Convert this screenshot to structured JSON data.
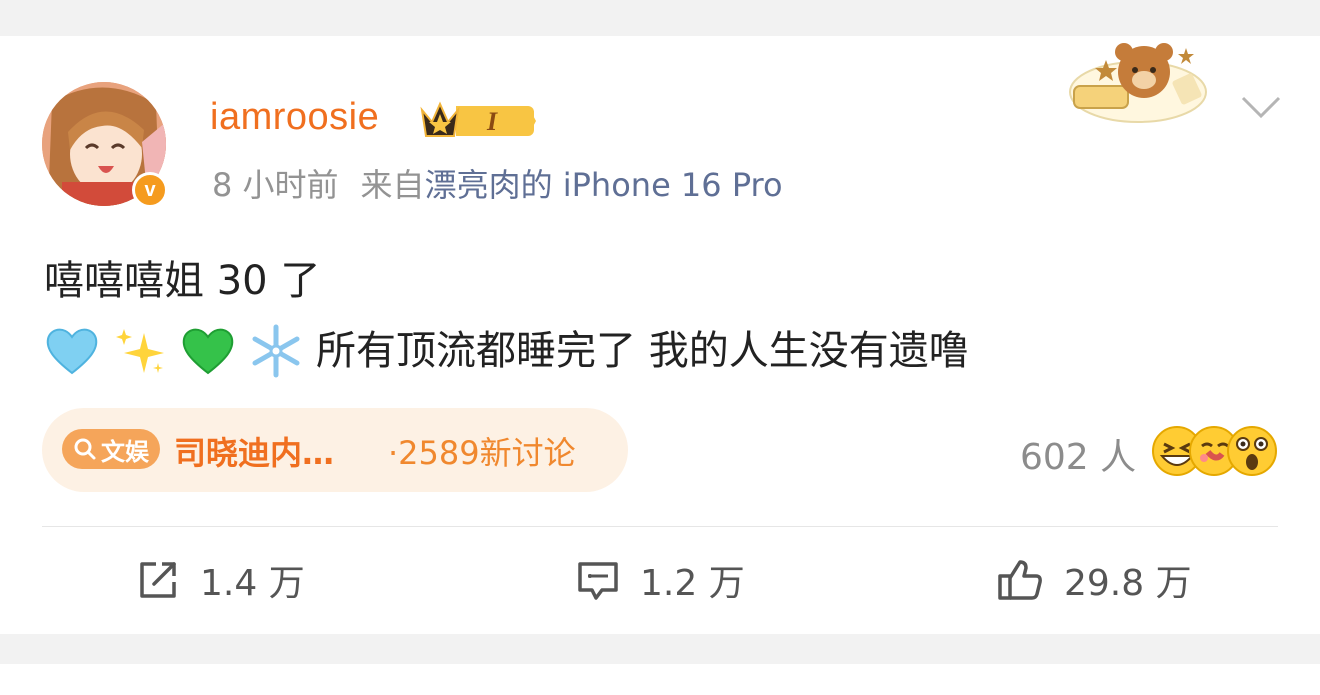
{
  "post": {
    "username": "iamroosie",
    "badge_level": "I",
    "time": "8 小时前",
    "source_prefix": "来自",
    "source": "漂亮肉的 iPhone 16 Pro",
    "text_line1": "嘻嘻嘻姐 30 了",
    "text_line2": "所有顶流都睡完了 我的人生没有遗噜",
    "line2_emojis": [
      "light-blue-heart",
      "sparkles",
      "green-heart",
      "snowflake"
    ]
  },
  "topic": {
    "tag_label": "文娱",
    "title": "司晓迪内…",
    "count": "·2589新讨论"
  },
  "reactions": {
    "count": "602 人"
  },
  "actions": {
    "repost": "1.4 万",
    "comment": "1.2 万",
    "like": "29.8 万"
  },
  "colors": {
    "username": "#f06f1f",
    "source_link": "#5f6f95",
    "topic_bg": "#fdf1e4",
    "badge": "#f59b1e"
  }
}
